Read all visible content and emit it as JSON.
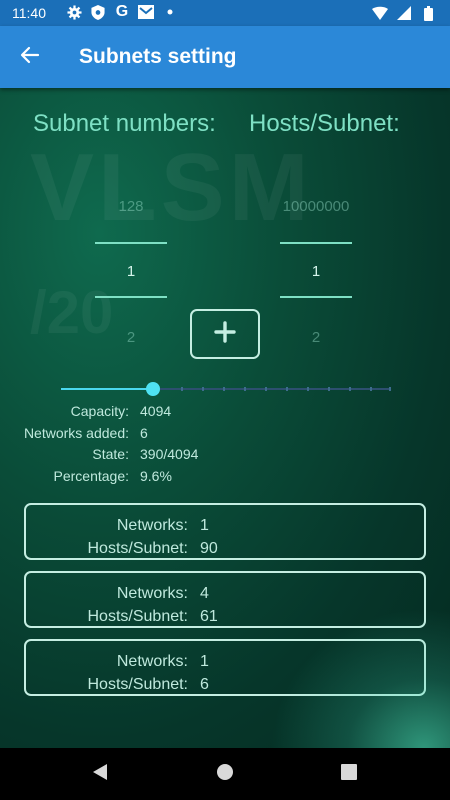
{
  "status_bar": {
    "time": "11:40",
    "left_icons": [
      "gear-icon",
      "shield-icon",
      "google-icon",
      "mail-icon",
      "dot-icon"
    ],
    "right_icons": [
      "wifi-icon",
      "signal-icon",
      "battery-icon"
    ]
  },
  "app_bar": {
    "title": "Subnets setting",
    "back_icon": "arrow-left-icon",
    "color": "#2b88d8"
  },
  "watermark": {
    "line1": "VLSM",
    "line2": "/20"
  },
  "headings": {
    "subnet_numbers": "Subnet numbers:",
    "hosts_per_subnet": "Hosts/Subnet:"
  },
  "pickers": {
    "subnets": {
      "prev": "128",
      "current": "1",
      "next": "2"
    },
    "hosts": {
      "prev": "10000000",
      "current": "1",
      "next": "2"
    }
  },
  "add_button": {
    "icon": "plus-icon"
  },
  "slider": {
    "fraction": 0.28
  },
  "info": {
    "capacity": {
      "label": "Capacity:",
      "value": "4094"
    },
    "networks_added": {
      "label": "Networks added:",
      "value": "6"
    },
    "state": {
      "label": "State:",
      "value": "390/4094"
    },
    "percentage": {
      "label": "Percentage:",
      "value": "9.6%"
    }
  },
  "cards": [
    {
      "networks_label": "Networks:",
      "networks": "1",
      "hosts_label": "Hosts/Subnet:",
      "hosts": "90"
    },
    {
      "networks_label": "Networks:",
      "networks": "4",
      "hosts_label": "Hosts/Subnet:",
      "hosts": "61"
    },
    {
      "networks_label": "Networks:",
      "networks": "1",
      "hosts_label": "Hosts/Subnet:",
      "hosts": "6"
    }
  ],
  "nav_bar": {
    "back": "back-triangle-icon",
    "home": "home-circle-icon",
    "recents": "recents-square-icon"
  },
  "colors": {
    "accent": "#7ee0c4",
    "slider_active": "#4fe2f2",
    "background": "#06362a"
  }
}
